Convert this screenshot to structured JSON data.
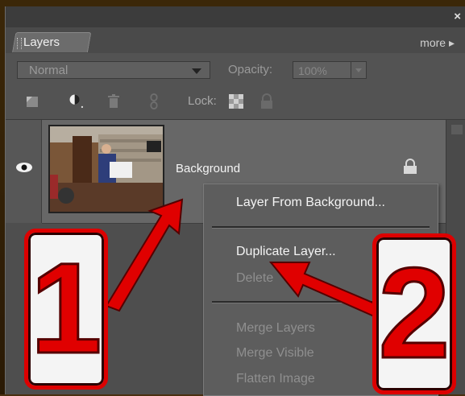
{
  "titlebar": {
    "close_glyph": "×"
  },
  "tab": {
    "label": "Layers",
    "more_label": "more ▸"
  },
  "toolbar": {
    "blend_mode": "Normal",
    "opacity_label": "Opacity:",
    "opacity_value": "100%",
    "lock_label": "Lock:"
  },
  "layers": [
    {
      "name": "Background",
      "visible": true,
      "locked": true
    }
  ],
  "context_menu": {
    "items": [
      {
        "label": "Layer From Background...",
        "enabled": true
      },
      {
        "label": "Duplicate Layer...",
        "enabled": true
      },
      {
        "label": "Delete",
        "enabled": false
      },
      {
        "label": "Merge Layers",
        "enabled": false
      },
      {
        "label": "Merge Visible",
        "enabled": false
      },
      {
        "label": "Flatten Image",
        "enabled": false
      }
    ]
  },
  "callouts": [
    {
      "label": "1"
    },
    {
      "label": "2"
    }
  ],
  "colors": {
    "panel": "#535353",
    "callout_red": "#e00000"
  }
}
